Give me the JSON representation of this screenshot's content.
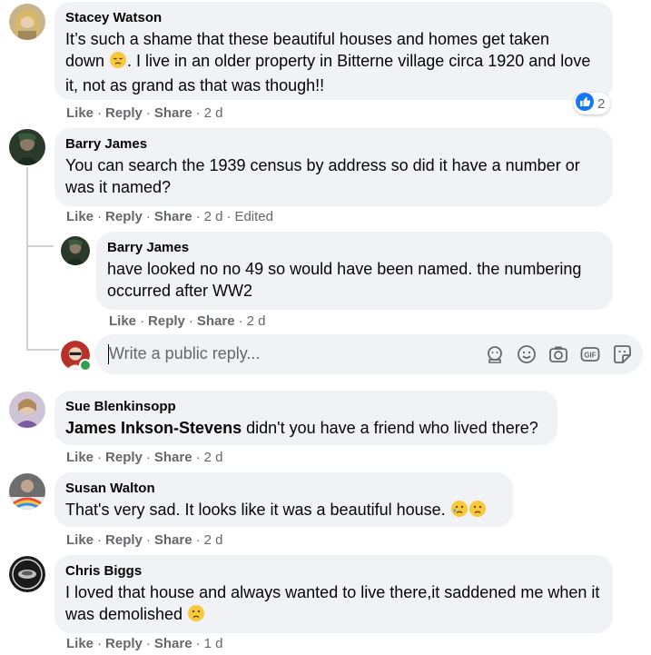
{
  "comments": [
    {
      "author": "Stacey Watson",
      "text_before_emoji": "It’s such a shame that these beautiful houses and homes get taken",
      "text_line2_start": "down",
      "text_after_emoji": ". I live in an older property in Bitterne village circa 1920 and love it, not as grand as that was though!!",
      "reaction_count": "2",
      "like": "Like",
      "reply": "Reply",
      "share": "Share",
      "time": "2 d"
    },
    {
      "author": "Barry James",
      "text": "You can search the 1939 census by address so did it have a number or was it named?",
      "like": "Like",
      "reply": "Reply",
      "share": "Share",
      "time": "2 d",
      "edited": "Edited"
    },
    {
      "author": "Barry James",
      "text": "have looked no no 49 so would have been named. the numbering occurred after WW2",
      "like": "Like",
      "reply": "Reply",
      "share": "Share",
      "time": "2 d"
    },
    {
      "author": "Sue Blenkinsopp",
      "mention": "James Inkson-Stevens",
      "text": " didn't you have a friend who lived there?",
      "like": "Like",
      "reply": "Reply",
      "share": "Share",
      "time": "2 d"
    },
    {
      "author": "Susan Walton",
      "text": "That's very sad. It looks like it was a beautiful house.",
      "like": "Like",
      "reply": "Reply",
      "share": "Share",
      "time": "2 d"
    },
    {
      "author": "Chris Biggs",
      "text": "I loved that house and always wanted to live there,it saddened me when it was demolished",
      "like": "Like",
      "reply": "Reply",
      "share": "Share",
      "time": "1 d"
    }
  ],
  "reply_box": {
    "placeholder": "Write a public reply...",
    "icons": [
      "avatar-sticker-icon",
      "emoji-icon",
      "camera-icon",
      "gif-icon",
      "sticker-icon"
    ]
  },
  "colors": {
    "bubble": "#f0f2f5",
    "meta_text": "#65676b",
    "like_blue": "#1877f2",
    "online_green": "#31a24c"
  }
}
